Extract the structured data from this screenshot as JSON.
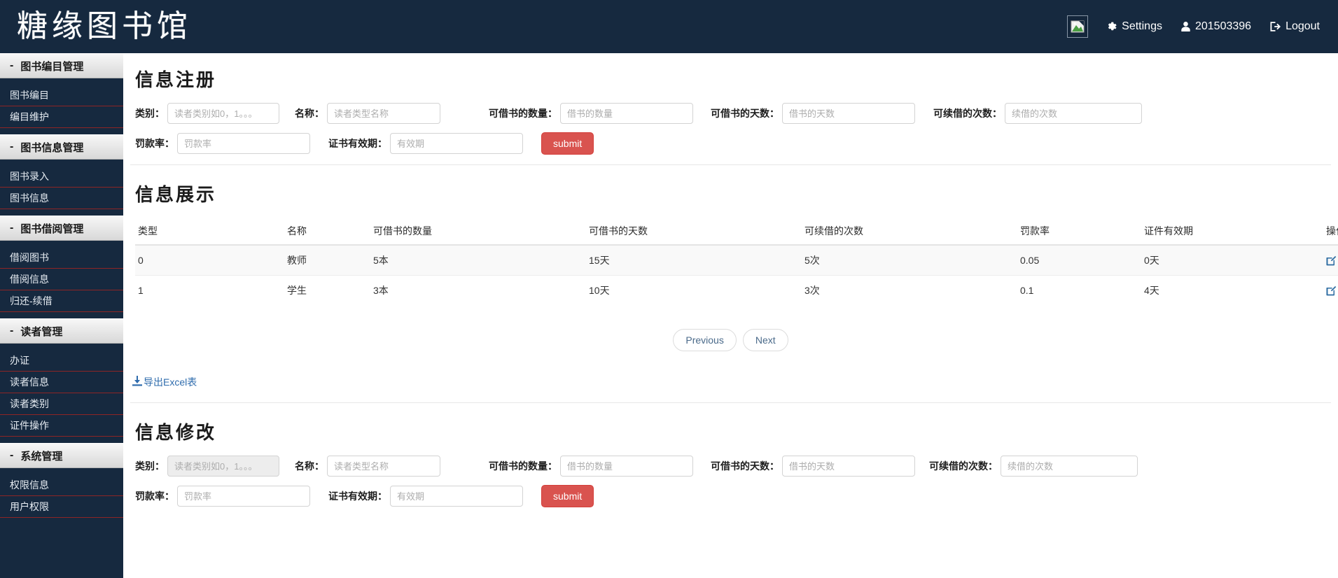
{
  "header": {
    "brand": "糖缘图书馆",
    "avatar_icon": "broken-image-icon",
    "settings_label": "Settings",
    "settings_icon": "gear-icon",
    "user_label": "201503396",
    "user_icon": "user-icon",
    "logout_label": "Logout",
    "logout_icon": "logout-icon",
    "bg_color": "#16293f"
  },
  "sidebar": {
    "toggle_glyph": "-",
    "sections": [
      {
        "title": "图书编目管理",
        "items": [
          {
            "label": "图书编目"
          },
          {
            "label": "编目维护"
          }
        ]
      },
      {
        "title": "图书信息管理",
        "items": [
          {
            "label": "图书录入"
          },
          {
            "label": "图书信息"
          }
        ]
      },
      {
        "title": "图书借阅管理",
        "items": [
          {
            "label": "借阅图书"
          },
          {
            "label": "借阅信息"
          },
          {
            "label": "归还-续借"
          }
        ]
      },
      {
        "title": "读者管理",
        "items": [
          {
            "label": "办证"
          },
          {
            "label": "读者信息"
          },
          {
            "label": "读者类别"
          },
          {
            "label": "证件操作"
          }
        ]
      },
      {
        "title": "系统管理",
        "items": [
          {
            "label": "权限信息"
          },
          {
            "label": "用户权限"
          }
        ]
      }
    ]
  },
  "register_form": {
    "title": "信息注册",
    "labels": {
      "category": "类别：",
      "name": "名称：",
      "borrow_count": "可借书的数量：",
      "borrow_days": "可借书的天数：",
      "renew_count": "可续借的次数：",
      "fine_rate": "罚款率：",
      "valid_period": "证书有效期："
    },
    "placeholders": {
      "category": "读者类别如0，1。。。",
      "name": "读者类型名称",
      "borrow_count": "借书的数量",
      "borrow_days": "借书的天数",
      "renew_count": "续借的次数",
      "fine_rate": "罚款率",
      "valid_period": "有效期"
    },
    "values": {
      "category": "",
      "name": "",
      "borrow_count": "",
      "borrow_days": "",
      "renew_count": "",
      "fine_rate": "",
      "valid_period": ""
    },
    "submit_label": "submit",
    "submit_color": "#d9534f"
  },
  "display": {
    "title": "信息展示",
    "columns": [
      "类型",
      "名称",
      "可借书的数量",
      "可借书的天数",
      "可续借的次数",
      "罚款率",
      "证件有效期",
      "操作"
    ],
    "rows": [
      {
        "type": "0",
        "name": "教师",
        "borrow_count": "5本",
        "borrow_days": "15天",
        "renew_count": "5次",
        "fine_rate": "0.05",
        "valid_period": "0天",
        "edit_icon": "edit-icon",
        "delete_icon": "delete-x-icon"
      },
      {
        "type": "1",
        "name": "学生",
        "borrow_count": "3本",
        "borrow_days": "10天",
        "renew_count": "3次",
        "fine_rate": "0.1",
        "valid_period": "4天",
        "edit_icon": "edit-icon",
        "delete_icon": "delete-x-icon"
      }
    ],
    "pager": {
      "previous": "Previous",
      "next": "Next"
    },
    "export": {
      "label": "导出Excel表",
      "icon": "download-icon"
    }
  },
  "modify_form": {
    "title": "信息修改",
    "labels": {
      "category": "类别：",
      "name": "名称：",
      "borrow_count": "可借书的数量：",
      "borrow_days": "可借书的天数：",
      "renew_count": "可续借的次数：",
      "fine_rate": "罚款率：",
      "valid_period": "证书有效期："
    },
    "placeholders": {
      "category": "读者类别如0，1。。。",
      "name": "读者类型名称",
      "borrow_count": "借书的数量",
      "borrow_days": "借书的天数",
      "renew_count": "续借的次数",
      "fine_rate": "罚款率",
      "valid_period": "有效期"
    },
    "values": {
      "category": "",
      "name": "",
      "borrow_count": "",
      "borrow_days": "",
      "renew_count": "",
      "fine_rate": "",
      "valid_period": ""
    },
    "submit_label": "submit",
    "category_disabled": true
  }
}
